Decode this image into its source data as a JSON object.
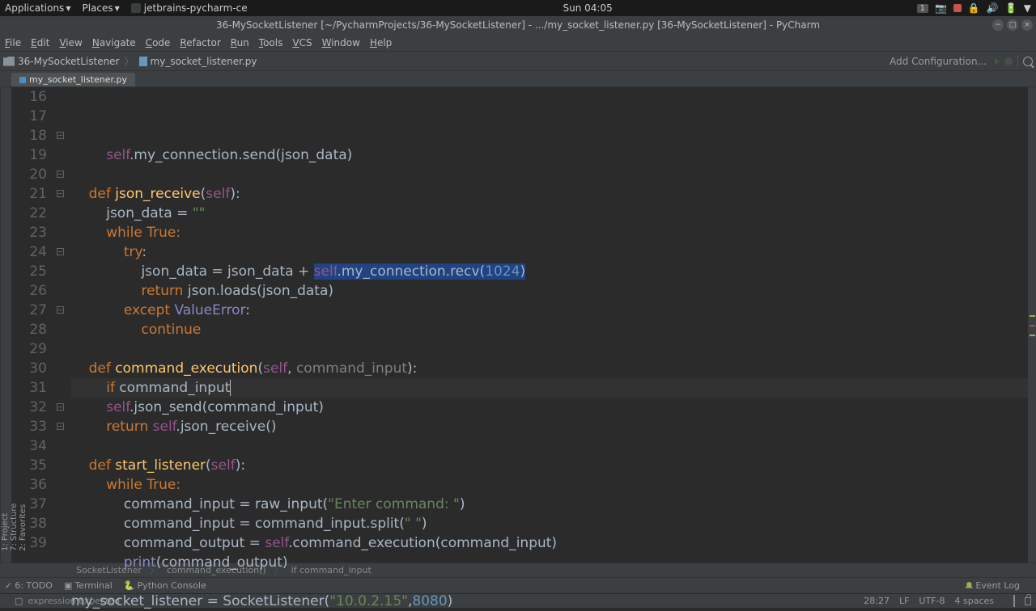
{
  "topbar": {
    "applications": "Applications",
    "places": "Places",
    "ide_name": "jetbrains-pycharm-ce",
    "clock": "Sun 04:05",
    "notif_badge": "1"
  },
  "window": {
    "title": "36-MySocketListener [~/PycharmProjects/36-MySocketListener] - .../my_socket_listener.py [36-MySocketListener] - PyCharm"
  },
  "menubar": [
    "File",
    "Edit",
    "View",
    "Navigate",
    "Code",
    "Refactor",
    "Run",
    "Tools",
    "VCS",
    "Window",
    "Help"
  ],
  "nav": {
    "project": "36-MySocketListener",
    "file": "my_socket_listener.py",
    "add_config": "Add Configuration..."
  },
  "tab": {
    "name": "my_socket_listener.py"
  },
  "side_left": [
    "1: Project",
    "7: Structure",
    "2: Favorites"
  ],
  "code_lines": [
    {
      "n": 16,
      "segs": [
        {
          "t": "        ",
          "c": ""
        },
        {
          "t": "self",
          "c": "self"
        },
        {
          "t": ".my_connection.send(json_data)",
          "c": ""
        }
      ]
    },
    {
      "n": 17,
      "segs": [
        {
          "t": "",
          "c": ""
        }
      ]
    },
    {
      "n": 18,
      "segs": [
        {
          "t": "    ",
          "c": ""
        },
        {
          "t": "def ",
          "c": "kw"
        },
        {
          "t": "json_receive",
          "c": "fn"
        },
        {
          "t": "(",
          "c": ""
        },
        {
          "t": "self",
          "c": "self"
        },
        {
          "t": "):",
          "c": ""
        }
      ]
    },
    {
      "n": 19,
      "segs": [
        {
          "t": "        json_data = ",
          "c": ""
        },
        {
          "t": "\"\"",
          "c": "str"
        }
      ]
    },
    {
      "n": 20,
      "segs": [
        {
          "t": "        ",
          "c": ""
        },
        {
          "t": "while ",
          "c": "kw"
        },
        {
          "t": "True:",
          "c": "kw"
        }
      ]
    },
    {
      "n": 21,
      "segs": [
        {
          "t": "            ",
          "c": ""
        },
        {
          "t": "try",
          "c": "kw"
        },
        {
          "t": ":",
          "c": ""
        }
      ]
    },
    {
      "n": 22,
      "segs": [
        {
          "t": "                json_data = json_data + ",
          "c": ""
        },
        {
          "t": "self",
          "c": "self hl"
        },
        {
          "t": ".my_connection.recv(",
          "c": "hl"
        },
        {
          "t": "1024",
          "c": "num hl"
        },
        {
          "t": ")",
          "c": "hl"
        }
      ]
    },
    {
      "n": 23,
      "segs": [
        {
          "t": "                ",
          "c": ""
        },
        {
          "t": "return ",
          "c": "kw"
        },
        {
          "t": "json.loads(json_data)",
          "c": ""
        }
      ]
    },
    {
      "n": 24,
      "segs": [
        {
          "t": "            ",
          "c": ""
        },
        {
          "t": "except ",
          "c": "kw"
        },
        {
          "t": "ValueError",
          "c": "builtin"
        },
        {
          "t": ":",
          "c": ""
        }
      ]
    },
    {
      "n": 25,
      "segs": [
        {
          "t": "                ",
          "c": ""
        },
        {
          "t": "continue",
          "c": "kw"
        }
      ]
    },
    {
      "n": 26,
      "segs": [
        {
          "t": "",
          "c": ""
        }
      ]
    },
    {
      "n": 27,
      "segs": [
        {
          "t": "    ",
          "c": ""
        },
        {
          "t": "def ",
          "c": "kw"
        },
        {
          "t": "command_execution",
          "c": "fn"
        },
        {
          "t": "(",
          "c": ""
        },
        {
          "t": "self",
          "c": "self"
        },
        {
          "t": ", ",
          "c": ""
        },
        {
          "t": "command_input",
          "c": "paramu"
        },
        {
          "t": "):",
          "c": ""
        }
      ]
    },
    {
      "n": 28,
      "segs": [
        {
          "t": "        ",
          "c": ""
        },
        {
          "t": "if ",
          "c": "kw"
        },
        {
          "t": "command_input",
          "c": ""
        }
      ],
      "cur": true
    },
    {
      "n": 29,
      "segs": [
        {
          "t": "        ",
          "c": ""
        },
        {
          "t": "self",
          "c": "self"
        },
        {
          "t": ".json_send(command_input)",
          "c": ""
        }
      ]
    },
    {
      "n": 30,
      "segs": [
        {
          "t": "        ",
          "c": ""
        },
        {
          "t": "return ",
          "c": "kw"
        },
        {
          "t": "self",
          "c": "self"
        },
        {
          "t": ".json_receive()",
          "c": ""
        }
      ]
    },
    {
      "n": 31,
      "segs": [
        {
          "t": "",
          "c": ""
        }
      ]
    },
    {
      "n": 32,
      "segs": [
        {
          "t": "    ",
          "c": ""
        },
        {
          "t": "def ",
          "c": "kw"
        },
        {
          "t": "start_listener",
          "c": "fn"
        },
        {
          "t": "(",
          "c": ""
        },
        {
          "t": "self",
          "c": "self"
        },
        {
          "t": "):",
          "c": ""
        }
      ]
    },
    {
      "n": 33,
      "segs": [
        {
          "t": "        ",
          "c": ""
        },
        {
          "t": "while ",
          "c": "kw"
        },
        {
          "t": "True:",
          "c": "kw"
        }
      ]
    },
    {
      "n": 34,
      "segs": [
        {
          "t": "            command_input = raw_input(",
          "c": ""
        },
        {
          "t": "\"Enter command: \"",
          "c": "str"
        },
        {
          "t": ")",
          "c": ""
        }
      ]
    },
    {
      "n": 35,
      "segs": [
        {
          "t": "            command_input = command_input.split(",
          "c": ""
        },
        {
          "t": "\" \"",
          "c": "str"
        },
        {
          "t": ")",
          "c": ""
        }
      ]
    },
    {
      "n": 36,
      "segs": [
        {
          "t": "            command_output = ",
          "c": ""
        },
        {
          "t": "self",
          "c": "self"
        },
        {
          "t": ".command_execution(command_input)",
          "c": ""
        }
      ]
    },
    {
      "n": 37,
      "segs": [
        {
          "t": "            ",
          "c": ""
        },
        {
          "t": "print",
          "c": "builtin"
        },
        {
          "t": "(command_output)",
          "c": ""
        }
      ]
    },
    {
      "n": 38,
      "segs": [
        {
          "t": "",
          "c": ""
        }
      ]
    },
    {
      "n": 39,
      "segs": [
        {
          "t": "my_socket_listener = SocketListener(",
          "c": ""
        },
        {
          "t": "\"10.0.2.15\"",
          "c": "str"
        },
        {
          "t": ",",
          "c": ""
        },
        {
          "t": "8080",
          "c": "num"
        },
        {
          "t": ")",
          "c": ""
        }
      ]
    }
  ],
  "breadcrumb": [
    "SocketListener",
    "command_execution()",
    "if command_input"
  ],
  "bottom_tools": {
    "todo": "6: TODO",
    "terminal": "Terminal",
    "python_console": "Python Console",
    "event_log": "Event Log"
  },
  "status": {
    "error": "expression expected",
    "cursor": "28:27",
    "encoding": "LF",
    "charset": "UTF-8",
    "indent": "4 spaces"
  }
}
